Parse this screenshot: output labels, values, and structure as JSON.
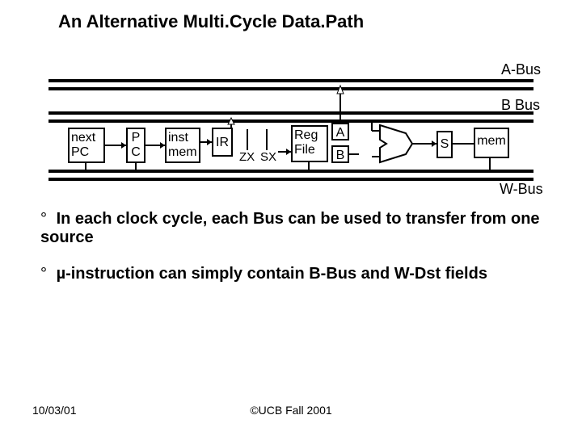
{
  "title": "An Alternative Multi.Cycle Data.Path",
  "bus": {
    "a": "A-Bus",
    "b": "B Bus",
    "w": "W-Bus"
  },
  "blocks": {
    "next_pc": "next\nPC",
    "pc": "P\nC",
    "inst_mem": "inst\nmem",
    "ir": "IR",
    "zx": "ZX",
    "sx": "SX",
    "reg_file": "Reg\nFile",
    "a": "A",
    "b": "B",
    "s": "S",
    "mem": "mem"
  },
  "bullets": [
    "In each clock cycle, each Bus can be used to transfer from one source",
    "µ-instruction can simply contain B-Bus and W-Dst fields"
  ],
  "bullet_marker": "°",
  "footer": {
    "date": "10/03/01",
    "copyright": "©UCB Fall 2001"
  }
}
